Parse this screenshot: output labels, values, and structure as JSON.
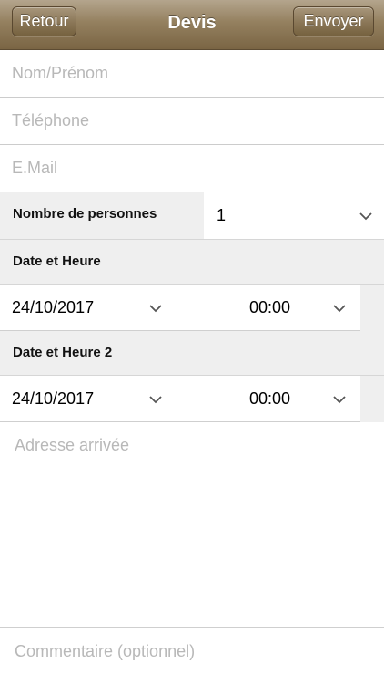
{
  "navbar": {
    "back_label": "Retour",
    "title": "Devis",
    "send_label": "Envoyer"
  },
  "form": {
    "name": {
      "placeholder": "Nom/Prénom",
      "value": ""
    },
    "phone": {
      "placeholder": "Téléphone",
      "value": ""
    },
    "email": {
      "placeholder": "E.Mail",
      "value": ""
    },
    "persons": {
      "label": "Nombre de personnes",
      "value": "1"
    },
    "datetime1": {
      "label": "Date et Heure",
      "date": "24/10/2017",
      "time": "00:00"
    },
    "datetime2": {
      "label": "Date et Heure 2",
      "date": "24/10/2017",
      "time": "00:00"
    },
    "address": {
      "placeholder": "Adresse arrivée",
      "value": ""
    },
    "comment": {
      "placeholder": "Commentaire (optionnel)",
      "value": ""
    }
  },
  "colors": {
    "navbar": "#94805f",
    "section_bg": "#efefef",
    "placeholder": "#b8b8b8"
  }
}
